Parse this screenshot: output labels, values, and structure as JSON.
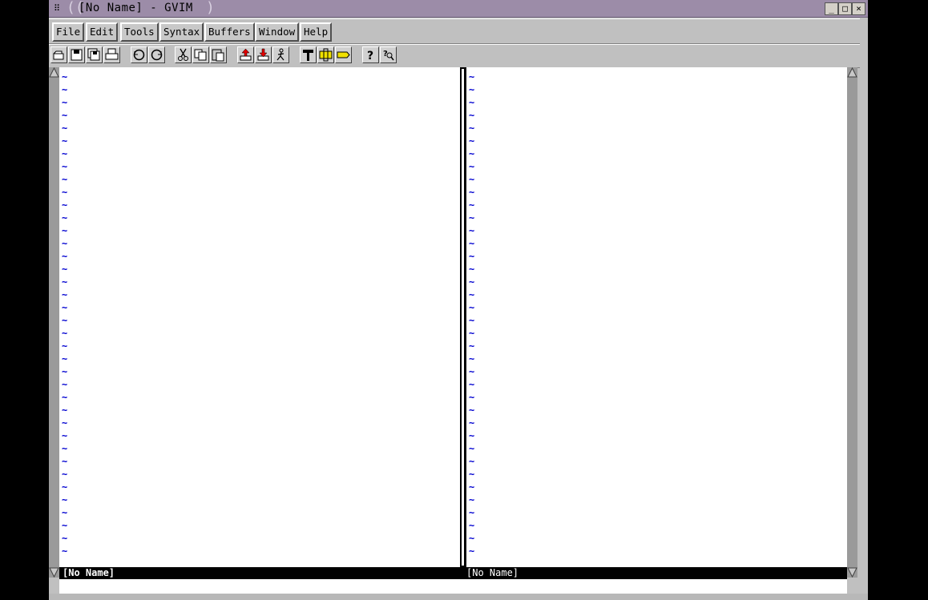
{
  "window": {
    "title": "[No Name] - GVIM",
    "controls": [
      "_",
      "□",
      "×"
    ]
  },
  "menubar": {
    "items": [
      {
        "label": "File"
      },
      {
        "label": "Edit"
      },
      {
        "label": "Tools"
      },
      {
        "label": "Syntax"
      },
      {
        "label": "Buffers"
      },
      {
        "label": "Window"
      },
      {
        "label": "Help"
      }
    ]
  },
  "toolbar": {
    "buttons": [
      {
        "icon": "open-icon"
      },
      {
        "icon": "save-icon"
      },
      {
        "icon": "save-all-icon"
      },
      {
        "icon": "print-icon"
      },
      {
        "icon": "undo-icon"
      },
      {
        "icon": "redo-icon"
      },
      {
        "icon": "cut-icon"
      },
      {
        "icon": "copy-icon"
      },
      {
        "icon": "paste-icon"
      },
      {
        "icon": "load-session-icon"
      },
      {
        "icon": "save-session-icon"
      },
      {
        "icon": "run-script-icon"
      },
      {
        "icon": "make-icon"
      },
      {
        "icon": "run-ctags-icon"
      },
      {
        "icon": "tag-jump-icon"
      },
      {
        "icon": "help-icon"
      },
      {
        "icon": "find-help-icon"
      }
    ]
  },
  "editor": {
    "left_pane": {
      "tildes": "~\n~\n~\n~\n~\n~\n~\n~\n~\n~\n~\n~\n~\n~\n~\n~\n~\n~\n~\n~\n~\n~\n~\n~\n~\n~\n~\n~\n~\n~\n~\n~\n~\n~\n~\n~\n~\n~",
      "status": "[No Name]"
    },
    "right_pane": {
      "tildes": "~\n~\n~\n~\n~\n~\n~\n~\n~\n~\n~\n~\n~\n~\n~\n~\n~\n~\n~\n~\n~\n~\n~\n~\n~\n~\n~\n~\n~\n~\n~\n~\n~\n~\n~\n~\n~\n~",
      "status": "[No Name]"
    }
  },
  "colors": {
    "titlebar": "#9c8ca8",
    "tilde": "#0000d0",
    "statusline": "#000000"
  }
}
